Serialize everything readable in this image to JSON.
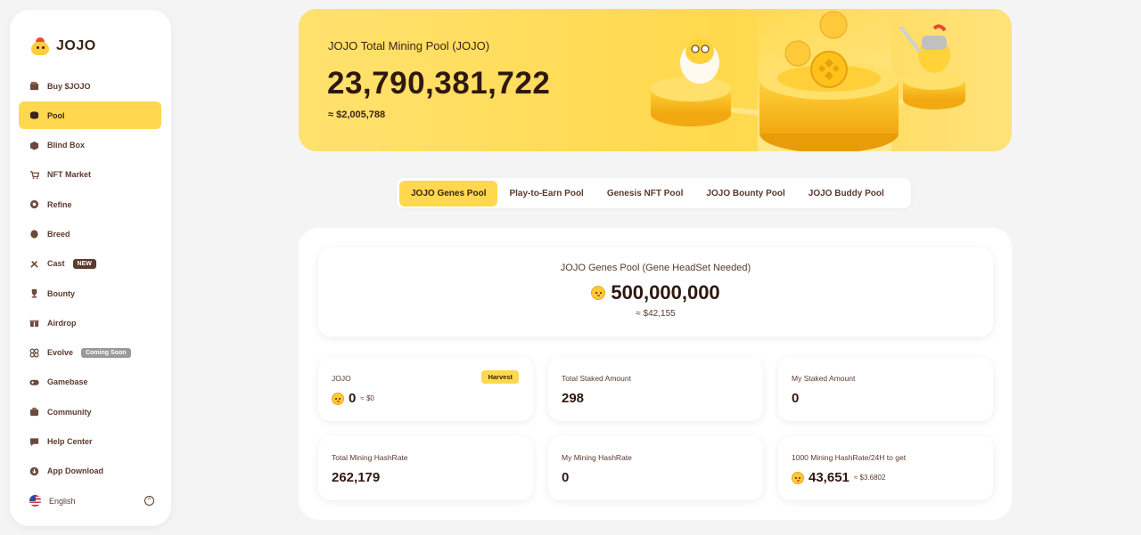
{
  "sidebar": {
    "logo_text": "JOJO",
    "items": [
      {
        "label": "Buy $JOJO",
        "icon": "wallet-icon"
      },
      {
        "label": "Pool",
        "icon": "pool-icon",
        "active": true
      },
      {
        "label": "Blind Box",
        "icon": "box-icon"
      },
      {
        "label": "NFT Market",
        "icon": "cart-icon"
      },
      {
        "label": "Refine",
        "icon": "refine-icon"
      },
      {
        "label": "Breed",
        "icon": "breed-icon"
      },
      {
        "label": "Cast",
        "icon": "tools-icon",
        "badge": "NEW"
      },
      {
        "label": "Bounty",
        "icon": "trophy-icon"
      },
      {
        "label": "Airdrop",
        "icon": "gift-icon"
      },
      {
        "label": "Evolve",
        "icon": "evolve-icon",
        "badge": "Coming Soon"
      },
      {
        "label": "Gamebase",
        "icon": "gamepad-icon"
      },
      {
        "label": "Community",
        "icon": "community-icon"
      },
      {
        "label": "Help Center",
        "icon": "chat-icon"
      },
      {
        "label": "App Download",
        "icon": "download-icon"
      }
    ],
    "language": "English"
  },
  "hero": {
    "title": "JOJO Total Mining Pool (JOJO)",
    "value": "23,790,381,722",
    "usd": "≈ $2,005,788"
  },
  "tabs": [
    {
      "label": "JOJO Genes Pool",
      "active": true
    },
    {
      "label": "Play-to-Earn Pool"
    },
    {
      "label": "Genesis NFT Pool"
    },
    {
      "label": "JOJO Bounty Pool"
    },
    {
      "label": "JOJO Buddy Pool"
    }
  ],
  "pool": {
    "title": "JOJO Genes Pool (Gene HeadSet Needed)",
    "amount": "500,000,000",
    "usd": "≈ $42,155"
  },
  "stats": {
    "jojo": {
      "label": "JOJO",
      "value": "0",
      "sub": "≈ $0",
      "harvest": "Harvest"
    },
    "total_staked": {
      "label": "Total Staked Amount",
      "value": "298"
    },
    "my_staked": {
      "label": "My Staked Amount",
      "value": "0"
    },
    "total_hashrate": {
      "label": "Total Mining HashRate",
      "value": "262,179"
    },
    "my_hashrate": {
      "label": "My Mining HashRate",
      "value": "0"
    },
    "per_1000": {
      "label": "1000 Mining HashRate/24H to get",
      "value": "43,651",
      "sub": "≈ $3.6802"
    }
  },
  "colors": {
    "accent": "#ffd84f",
    "text": "#3a2418",
    "background": "#f4f4f4"
  }
}
